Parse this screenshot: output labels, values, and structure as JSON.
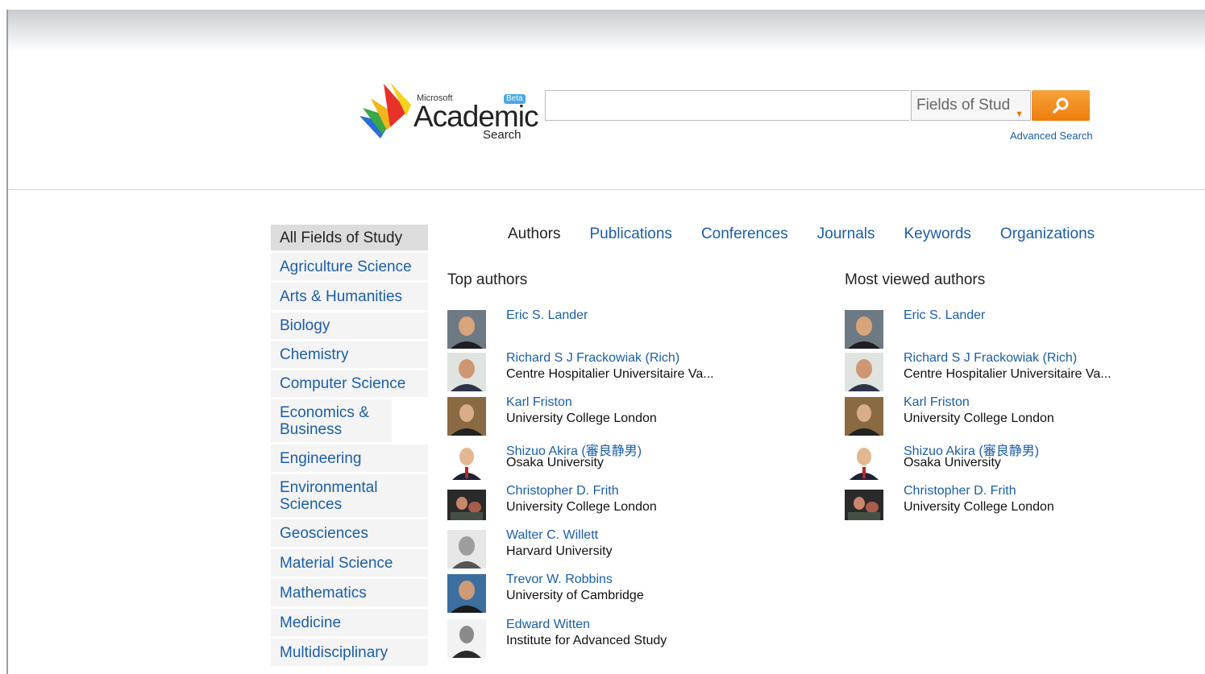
{
  "brand": {
    "microsoft": "Microsoft",
    "academic": "Academic",
    "search": "Search",
    "beta": "Beta",
    "colors": {
      "accent_orange": "#ee7d0b",
      "link_blue": "#1a5ea8"
    }
  },
  "search": {
    "value": "",
    "field_selected": "Fields of Stud",
    "button_icon": "search-icon",
    "advanced_label": "Advanced Search"
  },
  "sidebar": {
    "items": [
      {
        "label": "All Fields of Study",
        "active": true
      },
      {
        "label": "Agriculture Science"
      },
      {
        "label": "Arts & Humanities"
      },
      {
        "label": "Biology"
      },
      {
        "label": "Chemistry"
      },
      {
        "label": "Computer Science"
      },
      {
        "label": "Economics & Business"
      },
      {
        "label": "Engineering"
      },
      {
        "label": "Environmental Sciences"
      },
      {
        "label": "Geosciences"
      },
      {
        "label": "Material Science"
      },
      {
        "label": "Mathematics"
      },
      {
        "label": "Medicine"
      },
      {
        "label": "Multidisciplinary"
      }
    ]
  },
  "tabs": [
    {
      "label": "Authors",
      "active": true
    },
    {
      "label": "Publications"
    },
    {
      "label": "Conferences"
    },
    {
      "label": "Journals"
    },
    {
      "label": "Keywords"
    },
    {
      "label": "Organizations"
    }
  ],
  "top_authors": {
    "title": "Top authors",
    "items": [
      {
        "name": "Eric S. Lander",
        "affiliation": ""
      },
      {
        "name": "Richard S J Frackowiak (Rich)",
        "affiliation": "Centre Hospitalier Universitaire Va..."
      },
      {
        "name": "Karl Friston",
        "affiliation": "University College London"
      },
      {
        "name": "Shizuo Akira (審良静男)",
        "affiliation": "Osaka University"
      },
      {
        "name": "Christopher D. Frith",
        "affiliation": "University College London"
      },
      {
        "name": "Walter C. Willett",
        "affiliation": "Harvard University"
      },
      {
        "name": "Trevor W. Robbins",
        "affiliation": "University of Cambridge"
      },
      {
        "name": "Edward Witten",
        "affiliation": "Institute for Advanced Study"
      }
    ]
  },
  "most_viewed": {
    "title": "Most viewed authors",
    "items": [
      {
        "name": "Eric S. Lander",
        "affiliation": ""
      },
      {
        "name": "Richard S J Frackowiak (Rich)",
        "affiliation": "Centre Hospitalier Universitaire Va..."
      },
      {
        "name": "Karl Friston",
        "affiliation": "University College London"
      },
      {
        "name": "Shizuo Akira (審良静男)",
        "affiliation": "Osaka University"
      },
      {
        "name": "Christopher D. Frith",
        "affiliation": "University College London"
      }
    ]
  }
}
